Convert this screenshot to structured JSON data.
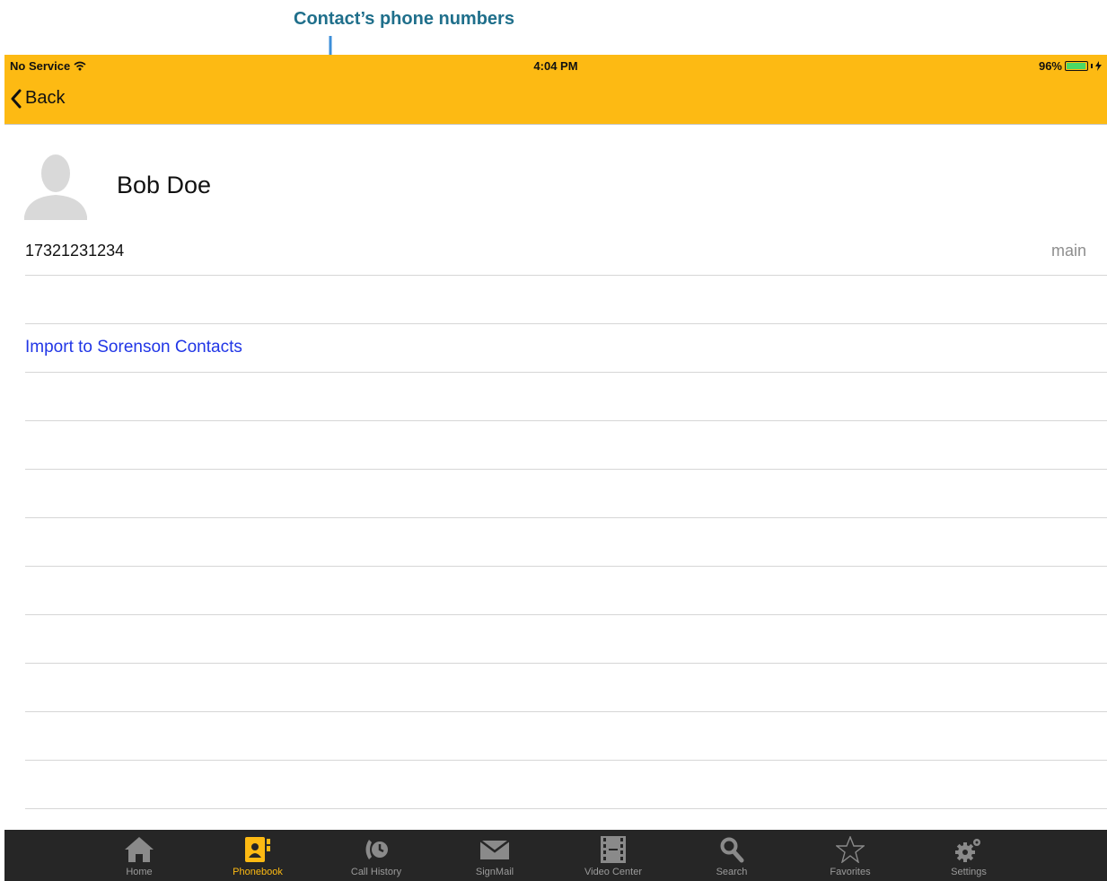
{
  "callout": {
    "label": "Contact’s phone numbers"
  },
  "status_bar": {
    "carrier": "No Service",
    "time": "4:04 PM",
    "battery_percent": "96%",
    "battery_level": 0.96
  },
  "nav": {
    "back_label": "Back"
  },
  "contact": {
    "name": "Bob Doe",
    "phones": [
      {
        "number": "17321231234",
        "type": "main"
      }
    ],
    "import_label": "Import to Sorenson Contacts"
  },
  "tab_bar": {
    "active_tab": "Phonebook",
    "tabs": [
      {
        "label": "Home",
        "icon": "home-icon"
      },
      {
        "label": "Phonebook",
        "icon": "phonebook-icon"
      },
      {
        "label": "Call History",
        "icon": "call-history-icon"
      },
      {
        "label": "SignMail",
        "icon": "mail-icon"
      },
      {
        "label": "Video Center",
        "icon": "film-icon"
      },
      {
        "label": "Search",
        "icon": "search-icon"
      },
      {
        "label": "Favorites",
        "icon": "star-icon"
      },
      {
        "label": "Settings",
        "icon": "gear-icon"
      }
    ]
  },
  "colors": {
    "accent": "#fdba13",
    "callout": "#1f6f8b",
    "arrow": "#3d8fd9",
    "link": "#2136e6",
    "tab_bar_bg": "#262626"
  }
}
